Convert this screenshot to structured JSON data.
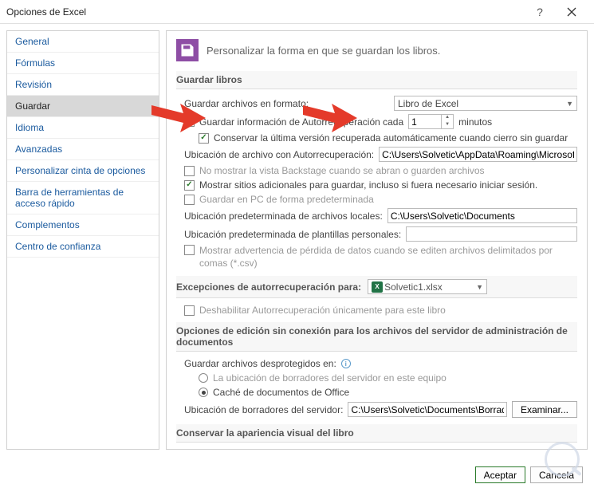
{
  "window": {
    "title": "Opciones de Excel"
  },
  "sidebar": {
    "items": [
      {
        "label": "General"
      },
      {
        "label": "Fórmulas"
      },
      {
        "label": "Revisión"
      },
      {
        "label": "Guardar"
      },
      {
        "label": "Idioma"
      },
      {
        "label": "Avanzadas"
      },
      {
        "label": "Personalizar cinta de opciones"
      },
      {
        "label": "Barra de herramientas de acceso rápido"
      },
      {
        "label": "Complementos"
      },
      {
        "label": "Centro de confianza"
      }
    ],
    "active_index": 3
  },
  "header": {
    "text": "Personalizar la forma en que se guardan los libros."
  },
  "sections": {
    "guardar_libros": {
      "title": "Guardar libros",
      "format_label": "Guardar archivos en formato:",
      "format_value": "Libro de Excel",
      "autosave_label": "Guardar información de Autorrecuperación cada",
      "autosave_value": "1",
      "autosave_unit": "minutos",
      "keep_last_label": "Conservar la última versión recuperada automáticamente cuando cierro sin guardar",
      "autorecover_path_label": "Ubicación de archivo con Autorrecuperación:",
      "autorecover_path_value": "C:\\Users\\Solvetic\\AppData\\Roaming\\Microsoft",
      "no_backstage_label": "No mostrar la vista Backstage cuando se abran o guarden archivos",
      "show_additional_label": "Mostrar sitios adicionales para guardar, incluso si fuera necesario iniciar sesión.",
      "save_pc_default_label": "Guardar en PC de forma predeterminada",
      "local_files_label": "Ubicación predeterminada de archivos locales:",
      "local_files_value": "C:\\Users\\Solvetic\\Documents",
      "personal_templates_label": "Ubicación predeterminada de plantillas personales:",
      "personal_templates_value": "",
      "csv_warning_label": "Mostrar advertencia de pérdida de datos cuando se editen archivos delimitados por comas (*.csv)"
    },
    "excepciones": {
      "title": "Excepciones de autorrecuperación para:",
      "workbook": "Solvetic1.xlsx",
      "disable_label": "Deshabilitar Autorrecuperación únicamente para este libro"
    },
    "offline": {
      "title": "Opciones de edición sin conexión para los archivos del servidor de administración de documentos",
      "save_unprotected_label": "Guardar archivos desprotegidos en:",
      "opt_server_drafts": "La ubicación de borradores del servidor en este equipo",
      "opt_office_cache": "Caché de documentos de Office",
      "drafts_path_label": "Ubicación de borradores del servidor:",
      "drafts_path_value": "C:\\Users\\Solvetic\\Documents\\Borradores de",
      "browse": "Examinar..."
    },
    "appearance": {
      "title": "Conservar la apariencia visual del libro"
    }
  },
  "footer": {
    "accept": "Aceptar",
    "cancel": "Cancela"
  }
}
